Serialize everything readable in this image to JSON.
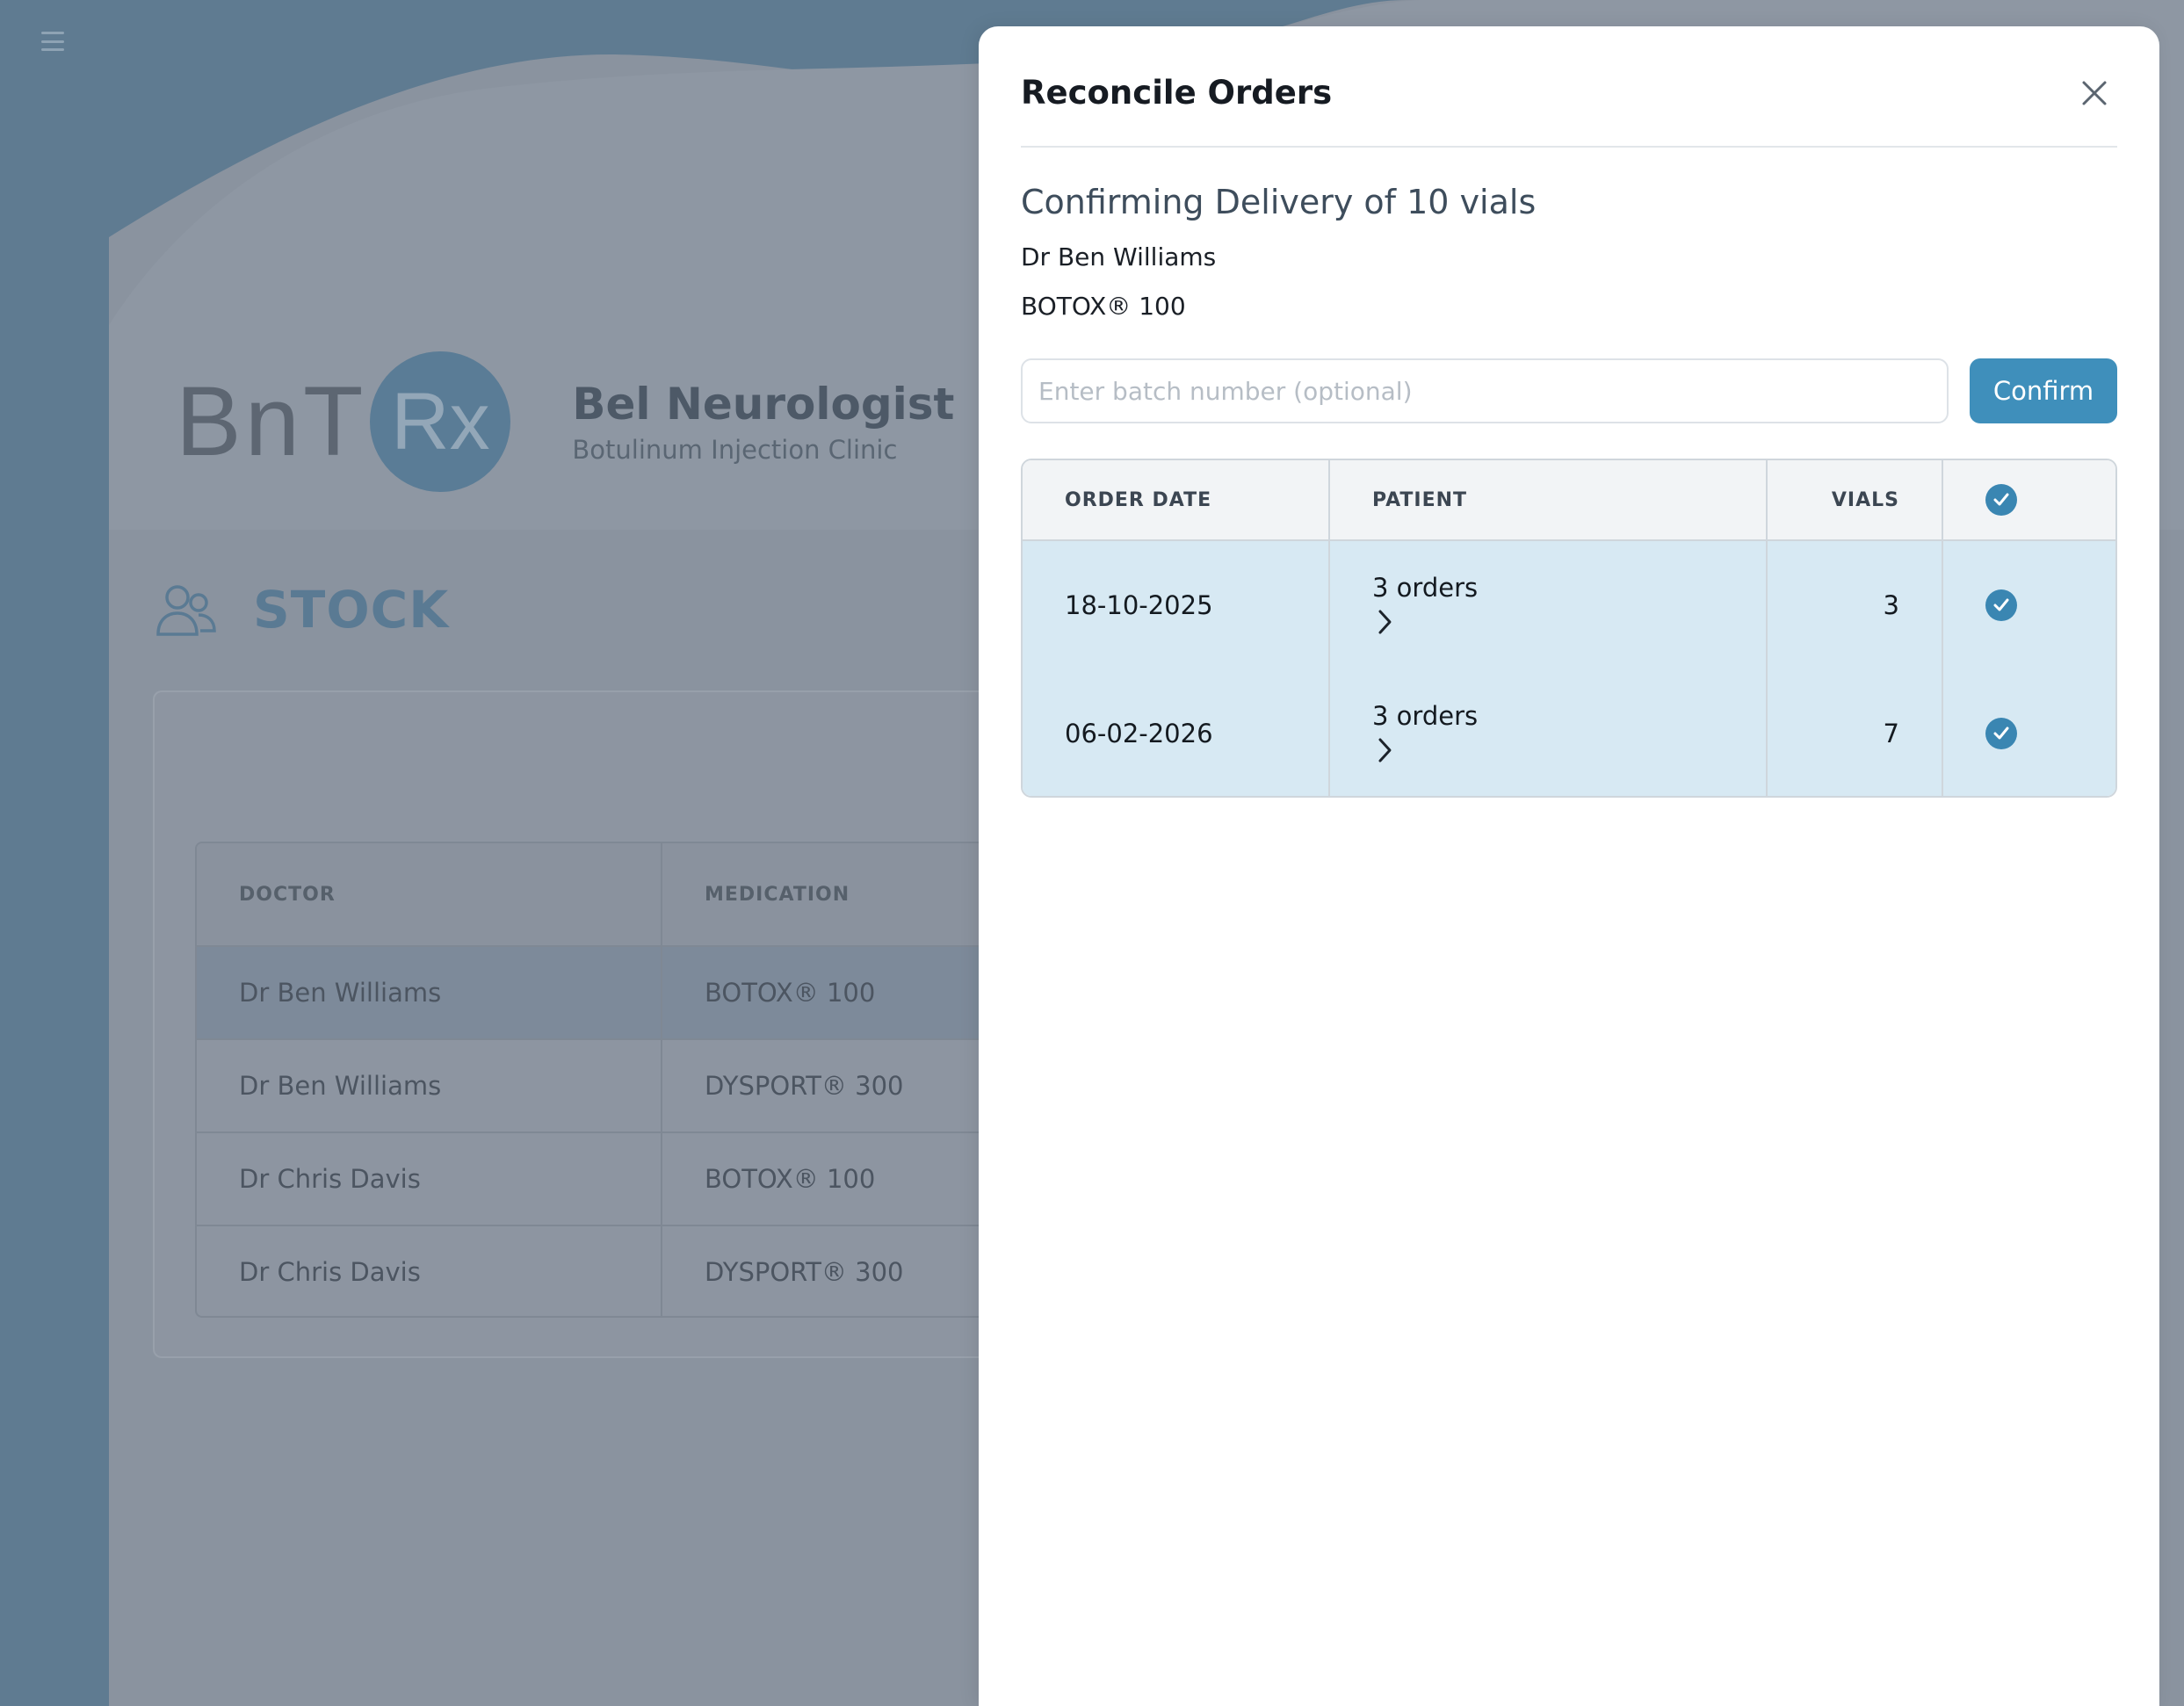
{
  "menu": {
    "icon": "hamburger-icon"
  },
  "brand": {
    "logo_letters": "BnT",
    "logo_rx": "Rx",
    "clinic_name": "Bel Neurologist",
    "clinic_subtitle": "Botulinum Injection Clinic"
  },
  "stock": {
    "title": "STOCK",
    "icon": "users-icon",
    "columns": {
      "doctor": "DOCTOR",
      "medication": "MEDICATION"
    },
    "rows": [
      {
        "doctor": "Dr Ben Williams",
        "medication": "BOTOX® 100"
      },
      {
        "doctor": "Dr Ben Williams",
        "medication": "DYSPORT® 300"
      },
      {
        "doctor": "Dr Chris Davis",
        "medication": "BOTOX® 100"
      },
      {
        "doctor": "Dr Chris Davis",
        "medication": "DYSPORT® 300"
      }
    ]
  },
  "modal": {
    "title": "Reconcile Orders",
    "close_icon": "close-icon",
    "heading": "Confirming Delivery of 10 vials",
    "doctor": "Dr Ben Williams",
    "medication": "BOTOX® 100",
    "batch_placeholder": "Enter batch number (optional)",
    "batch_value": "",
    "confirm_label": "Confirm",
    "table": {
      "columns": {
        "order_date": "ORDER DATE",
        "patient": "PATIENT",
        "vials": "VIALS"
      },
      "header_checked": true,
      "rows": [
        {
          "order_date": "18-10-2025",
          "patient": "3 orders",
          "vials": "3",
          "checked": true
        },
        {
          "order_date": "06-02-2026",
          "patient": "3 orders",
          "vials": "7",
          "checked": true
        }
      ]
    }
  },
  "colors": {
    "accent": "#3f8fbb",
    "check": "#3a86b2",
    "row_highlight": "#d7e9f3",
    "overlay": "#5f7b91"
  }
}
